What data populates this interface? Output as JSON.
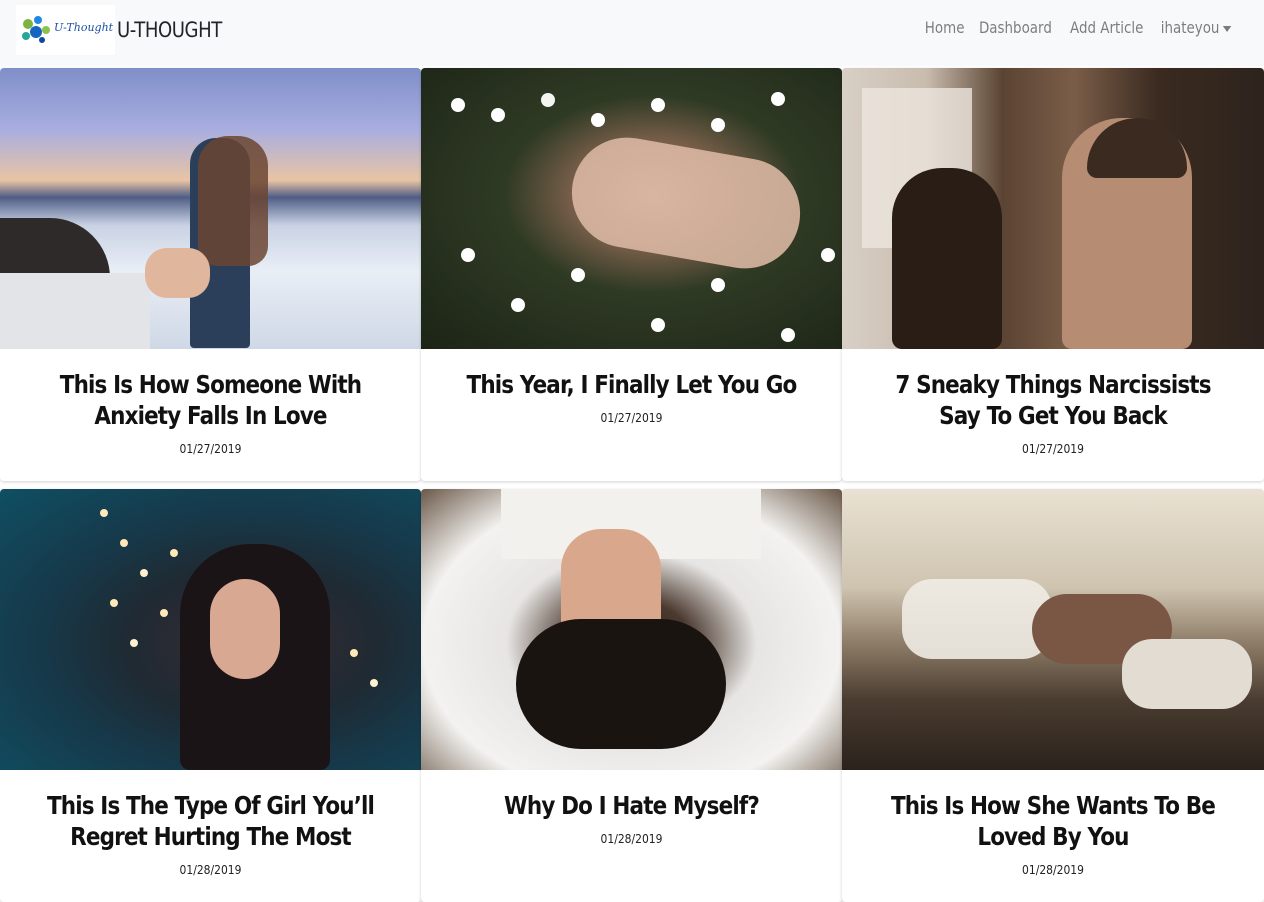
{
  "brand": {
    "logo_text": "U-Thought",
    "name": "U-THOUGHT"
  },
  "nav": {
    "items": [
      {
        "label": "Home"
      },
      {
        "label": "Dashboard"
      },
      {
        "label": "Add Article"
      }
    ],
    "user_menu": {
      "label": "ihateyou",
      "icon": "caret-down-icon"
    }
  },
  "articles": [
    {
      "title": "This Is How Someone With Anxiety Falls In Love",
      "date": "01/27/2019",
      "image": "couple-holding-hands-above-clouds"
    },
    {
      "title": "This Year, I Finally Let You Go",
      "date": "01/27/2019",
      "image": "woman-lying-in-daisies"
    },
    {
      "title": "7 Sneaky Things Narcissists Say To Get You Back",
      "date": "01/27/2019",
      "image": "couple-kissing"
    },
    {
      "title": "This Is The Type Of Girl You’ll Regret Hurting The Most",
      "date": "01/28/2019",
      "image": "girl-with-fairy-lights"
    },
    {
      "title": "Why Do I Hate Myself?",
      "date": "01/28/2019",
      "image": "woman-covering-face"
    },
    {
      "title": "This Is How She Wants To Be Loved By You",
      "date": "01/28/2019",
      "image": "woman-lying-in-bed"
    }
  ]
}
